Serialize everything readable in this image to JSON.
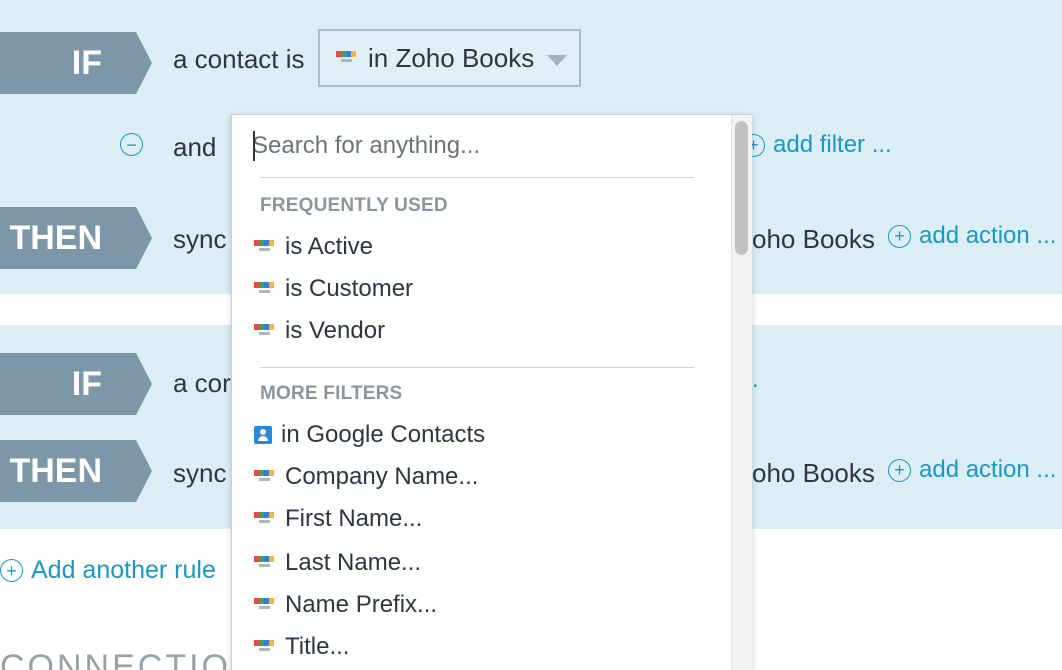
{
  "rule1": {
    "if_label": "IF",
    "if_text": "a contact is",
    "if_dropdown_value": "in Zoho Books",
    "and_text": "and",
    "add_filter": "add filter ...",
    "then_label": "THEN",
    "then_text": "sync",
    "then_target": "oho Books",
    "add_action": "add action ..."
  },
  "rule2": {
    "if_label": "IF",
    "if_text": "a cor",
    "if_trail": ".",
    "then_label": "THEN",
    "then_text": "sync",
    "then_target": "oho Books",
    "add_action": "add action ..."
  },
  "add_rule": "Add another rule",
  "bottom_heading": "CONNECTION",
  "dropdown": {
    "search_placeholder": "Search for anything...",
    "frequently_used_header": "FREQUENTLY USED",
    "frequently_used": [
      {
        "label": "is Active",
        "icon": "zoho-books-icon"
      },
      {
        "label": "is Customer",
        "icon": "zoho-books-icon"
      },
      {
        "label": "is Vendor",
        "icon": "zoho-books-icon"
      }
    ],
    "more_filters_header": "MORE FILTERS",
    "more_filters": [
      {
        "label": "in Google Contacts",
        "icon": "google-contacts-icon"
      },
      {
        "label": "Company Name...",
        "icon": "zoho-books-icon"
      },
      {
        "label": "First Name...",
        "icon": "zoho-books-icon"
      },
      {
        "label": "Last Name...",
        "icon": "zoho-books-icon"
      },
      {
        "label": "Name Prefix...",
        "icon": "zoho-books-icon"
      },
      {
        "label": "Title...",
        "icon": "zoho-books-icon"
      }
    ]
  },
  "colors": {
    "rule_bg": "#dbeef5",
    "tag_bg": "#7b97a8",
    "link": "#1b97c6"
  }
}
